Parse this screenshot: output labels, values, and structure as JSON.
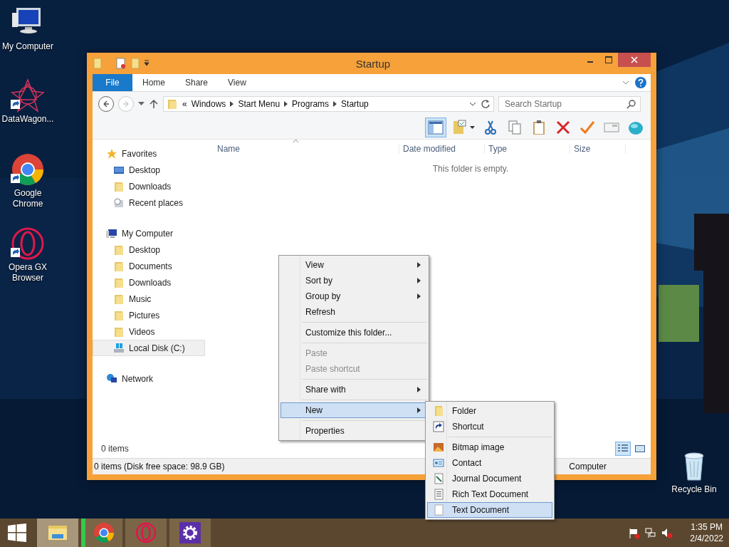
{
  "desktop_icons": [
    {
      "kind": "computer",
      "label": "My Computer",
      "shortcut": false
    },
    {
      "kind": "star-web",
      "label": "DataWagon...",
      "shortcut": true
    },
    {
      "kind": "chrome",
      "label": "Google Chrome",
      "shortcut": true
    },
    {
      "kind": "opera",
      "label": "Opera GX Browser",
      "shortcut": true
    },
    {
      "kind": "recycle",
      "label": "Recycle Bin",
      "shortcut": false
    }
  ],
  "window": {
    "title": "Startup",
    "ribbon_tabs": [
      {
        "kind": "file",
        "label": "File"
      },
      {
        "kind": "tab",
        "label": "Home"
      },
      {
        "kind": "tab",
        "label": "Share"
      },
      {
        "kind": "tab",
        "label": "View"
      }
    ],
    "nav_buttons": [
      {
        "kind": "back",
        "disabled": false
      },
      {
        "kind": "forward",
        "disabled": true
      }
    ],
    "address": {
      "prefix": "«",
      "segments": [
        "Windows",
        "Start Menu",
        "Programs",
        "Startup"
      ]
    },
    "search": {
      "placeholder": "Search Startup"
    },
    "toolbar": [
      {
        "kind": "pane",
        "selected": true
      },
      {
        "kind": "properties",
        "selected": false
      },
      {
        "kind": "cut",
        "selected": false
      },
      {
        "kind": "copy",
        "selected": false
      },
      {
        "kind": "paste",
        "selected": false
      },
      {
        "kind": "delete",
        "selected": false
      },
      {
        "kind": "rename",
        "selected": false
      },
      {
        "kind": "card",
        "selected": false
      },
      {
        "kind": "globe",
        "selected": false
      }
    ],
    "nav_tree": [
      {
        "kind": "star",
        "label": "Favorites",
        "selected": false,
        "children": [
          {
            "kind": "desktop",
            "label": "Desktop",
            "selected": false
          },
          {
            "kind": "folder",
            "label": "Downloads",
            "selected": false
          },
          {
            "kind": "recent",
            "label": "Recent places",
            "selected": false
          }
        ]
      },
      {
        "kind": "computer",
        "label": "My Computer",
        "selected": false,
        "children": [
          {
            "kind": "folder",
            "label": "Desktop",
            "selected": false
          },
          {
            "kind": "folder",
            "label": "Documents",
            "selected": false
          },
          {
            "kind": "folder",
            "label": "Downloads",
            "selected": false
          },
          {
            "kind": "folder",
            "label": "Music",
            "selected": false
          },
          {
            "kind": "folder",
            "label": "Pictures",
            "selected": false
          },
          {
            "kind": "folder",
            "label": "Videos",
            "selected": false
          },
          {
            "kind": "disk",
            "label": "Local Disk (C:)",
            "selected": true
          }
        ]
      },
      {
        "kind": "network",
        "label": "Network",
        "selected": false
      }
    ],
    "columns": [
      "Name",
      "Date modified",
      "Type",
      "Size"
    ],
    "empty_message": "This folder is empty.",
    "item_count": "0 items",
    "view_buttons": [
      {
        "kind": "details",
        "selected": true
      },
      {
        "kind": "large",
        "selected": false
      }
    ],
    "status_bar": {
      "text": "0 items (Disk free space: 98.9 GB)",
      "location": "Computer"
    }
  },
  "context_menu": {
    "groups": [
      [
        {
          "label": "View",
          "submenu": true,
          "disabled": false,
          "selected": false
        },
        {
          "label": "Sort by",
          "submenu": true,
          "disabled": false,
          "selected": false
        },
        {
          "label": "Group by",
          "submenu": true,
          "disabled": false,
          "selected": false
        },
        {
          "label": "Refresh",
          "submenu": false,
          "disabled": false,
          "selected": false
        }
      ],
      [
        {
          "label": "Customize this folder...",
          "submenu": false,
          "disabled": false,
          "selected": false
        }
      ],
      [
        {
          "label": "Paste",
          "submenu": false,
          "disabled": true,
          "selected": false
        },
        {
          "label": "Paste shortcut",
          "submenu": false,
          "disabled": true,
          "selected": false
        }
      ],
      [
        {
          "label": "Share with",
          "submenu": true,
          "disabled": false,
          "selected": false
        }
      ],
      [
        {
          "label": "New",
          "submenu": true,
          "disabled": false,
          "selected": true
        }
      ],
      [
        {
          "label": "Properties",
          "submenu": false,
          "disabled": false,
          "selected": false
        }
      ]
    ]
  },
  "submenu": {
    "groups": [
      [
        {
          "kind": "folder",
          "label": "Folder",
          "selected": false
        },
        {
          "kind": "shortcut",
          "label": "Shortcut",
          "selected": false
        }
      ],
      [
        {
          "kind": "bitmap",
          "label": "Bitmap image",
          "selected": false
        },
        {
          "kind": "contact",
          "label": "Contact",
          "selected": false
        },
        {
          "kind": "journal",
          "label": "Journal Document",
          "selected": false
        },
        {
          "kind": "rtf",
          "label": "Rich Text Document",
          "selected": false
        },
        {
          "kind": "text",
          "label": "Text Document",
          "selected": true
        }
      ]
    ]
  },
  "taskbar": {
    "apps": [
      {
        "kind": "explorer",
        "selected": true,
        "attention": false
      },
      {
        "kind": "chrome",
        "selected": false,
        "attention": true
      },
      {
        "kind": "opera",
        "selected": false,
        "attention": false
      },
      {
        "kind": "settings",
        "selected": false,
        "attention": false
      }
    ],
    "tray": [
      {
        "kind": "flag"
      },
      {
        "kind": "network"
      },
      {
        "kind": "volume"
      }
    ],
    "time": "1:35 PM",
    "date": "2/4/2022"
  }
}
